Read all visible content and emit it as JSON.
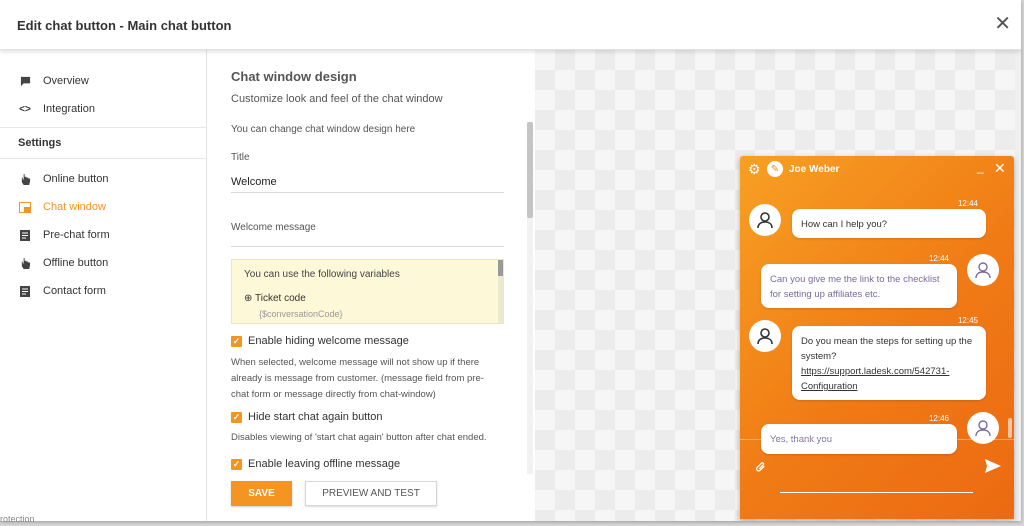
{
  "modal": {
    "title": "Edit chat button - Main chat button",
    "close": "✕"
  },
  "sidebar": {
    "top_items": [
      {
        "label": "Overview",
        "icon": "chat-bubble-icon"
      },
      {
        "label": "Integration",
        "icon": "code-icon"
      }
    ],
    "settings_heading": "Settings",
    "items": [
      {
        "label": "Online button",
        "icon": "hand-pointer-icon"
      },
      {
        "label": "Chat window",
        "icon": "window-icon",
        "active": true
      },
      {
        "label": "Pre-chat form",
        "icon": "form-icon"
      },
      {
        "label": "Offline button",
        "icon": "hand-pointer-icon"
      },
      {
        "label": "Contact form",
        "icon": "form-icon"
      }
    ]
  },
  "form": {
    "title": "Chat window design",
    "subtitle": "Customize look and feel of the chat window",
    "intro": "You can change chat window design here",
    "title_label": "Title",
    "title_value": "Welcome",
    "welcome_label": "Welcome message",
    "variables": {
      "heading": "You can use the following variables",
      "item": "Ticket code",
      "code": "{$conversationCode}"
    },
    "enable_hiding": {
      "label": "Enable hiding welcome message",
      "checked": true,
      "desc": "When selected, welcome message will not show up if there already is message from customer. (message field from pre-chat form or message directly from chat-window)"
    },
    "hide_start": {
      "label": "Hide start chat again button",
      "checked": true,
      "desc": "Disables viewing of 'start chat again' button after chat ended."
    },
    "enable_offline": {
      "label": "Enable leaving offline message",
      "checked": true
    },
    "save_label": "SAVE",
    "preview_label": "PREVIEW AND TEST"
  },
  "chat": {
    "agent_name": "Joe Weber",
    "accent": "#f08a1c",
    "messages": [
      {
        "from": "agent",
        "time": "12:44",
        "text": "How can I help you?"
      },
      {
        "from": "customer",
        "time": "12:44",
        "text": "Can you give me the link to the checklist for setting up affiliates etc."
      },
      {
        "from": "agent",
        "time": "12:45",
        "text": "Do you mean the steps for setting up the system?",
        "link": "https://support.ladesk.com/542731-Configuration"
      },
      {
        "from": "customer",
        "time": "12:46",
        "text": "Yes, thank you"
      }
    ]
  },
  "background_text": "rotection"
}
